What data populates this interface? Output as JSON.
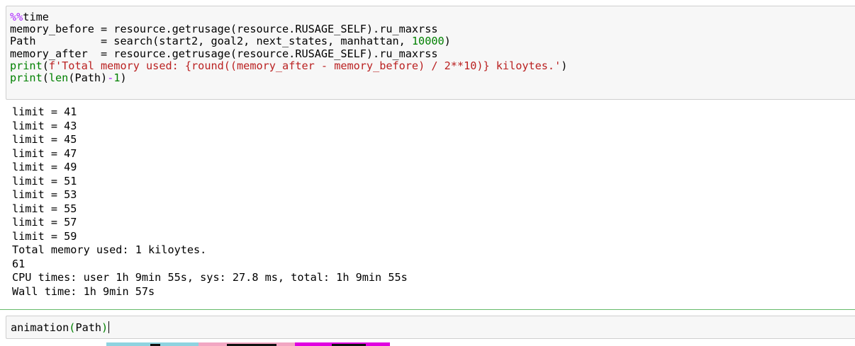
{
  "cell1": {
    "code_lines": [
      [
        "%%",
        "time"
      ],
      [
        "memory_before = resource.getrusage(resource.RUSAGE_SELF).ru_maxrss"
      ],
      [
        "Path          = search(start2, goal2, next_states, manhattan, ",
        "10000",
        ")"
      ],
      [
        "memory_after  = resource.getrusage(resource.RUSAGE_SELF).ru_maxrss"
      ],
      [
        "print",
        "(",
        "f'Total memory used: {round((memory_after - memory_before) / 2**10)} kiloytes.'",
        ")"
      ],
      [
        "print",
        "(",
        "len",
        "(Path)",
        "-",
        "1",
        ")"
      ]
    ]
  },
  "output": {
    "lines": [
      "limit = 41",
      "limit = 43",
      "limit = 45",
      "limit = 47",
      "limit = 49",
      "limit = 51",
      "limit = 53",
      "limit = 55",
      "limit = 57",
      "limit = 59",
      "Total memory used: 1 kiloytes.",
      "61",
      "CPU times: user 1h 9min 55s, sys: 27.8 ms, total: 1h 9min 55s",
      "Wall time: 1h 9min 57s"
    ]
  },
  "cell2": {
    "code_func": "animation",
    "code_open": "(",
    "code_arg": "Path",
    "code_close": ")"
  },
  "colors": {
    "magic": "#aa22ff",
    "builtin": "#008000",
    "string": "#ba2121",
    "number": "#008000",
    "selected_cell_border": "#66bb6a",
    "anim_cyan": "#8fd3e0",
    "anim_pink": "#f2a7c3",
    "anim_magenta": "#e000e0",
    "anim_black": "#111111"
  }
}
